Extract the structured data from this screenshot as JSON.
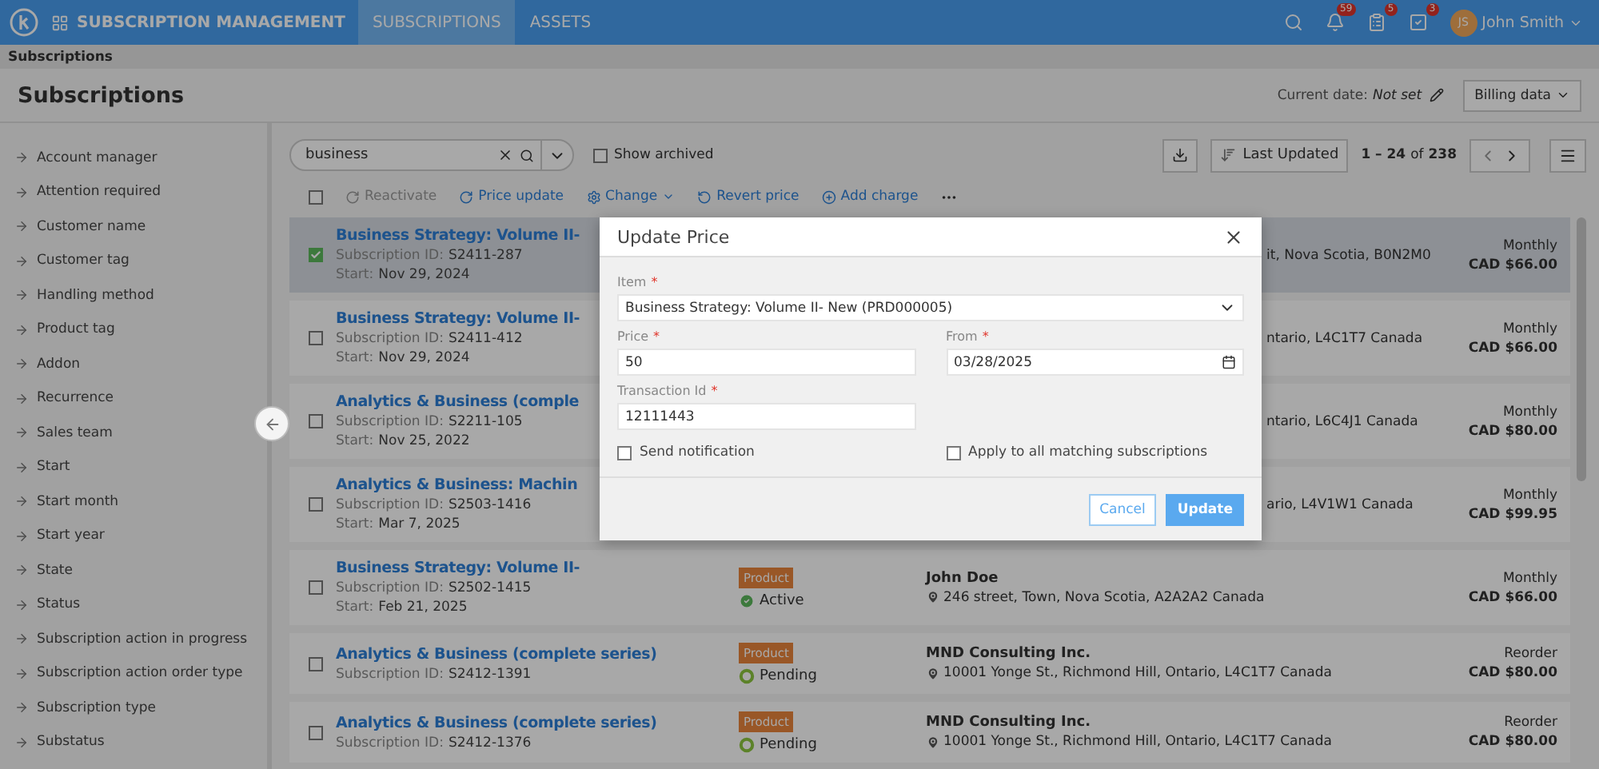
{
  "header": {
    "app_title": "SUBSCRIPTION MANAGEMENT",
    "nav": [
      {
        "label": "SUBSCRIPTIONS",
        "selected": true
      },
      {
        "label": "ASSETS",
        "selected": false
      }
    ],
    "notifications": [
      {
        "kind": "bell",
        "count": "59"
      },
      {
        "kind": "tasks",
        "count": "5"
      },
      {
        "kind": "approvals",
        "count": "3"
      }
    ],
    "user": {
      "initials": "JS",
      "name": "John Smith"
    }
  },
  "breadcrumb": "Subscriptions",
  "page": {
    "title": "Subscriptions",
    "current_date_label": "Current date:",
    "current_date_value": "Not set",
    "billing_button": "Billing data"
  },
  "sidebar": {
    "filters": [
      "Account manager",
      "Attention required",
      "Customer name",
      "Customer tag",
      "Handling method",
      "Product tag",
      "Addon",
      "Recurrence",
      "Sales team",
      "Start",
      "Start month",
      "Start year",
      "State",
      "Status",
      "Subscription action in progress",
      "Subscription action order type",
      "Subscription type",
      "Substatus"
    ]
  },
  "toolbar": {
    "search_value": "business",
    "show_archived": {
      "label": "Show archived",
      "checked": false
    },
    "sort_label": "Last Updated",
    "range": "1 – 24",
    "of": "of",
    "total": "238"
  },
  "select_all": {
    "checked": false
  },
  "actions": [
    {
      "label": "Reactivate",
      "disabled": true,
      "dropdown": false
    },
    {
      "label": "Price update",
      "disabled": false,
      "dropdown": false
    },
    {
      "label": "Change",
      "disabled": false,
      "dropdown": true
    },
    {
      "label": "Revert price",
      "disabled": false,
      "dropdown": false
    },
    {
      "label": "Add charge",
      "disabled": false,
      "dropdown": false
    }
  ],
  "subscriptions": [
    {
      "kind": "covered",
      "selected": true,
      "title": "Business Strategy: Volume II-",
      "id_label": "Subscription ID:",
      "id": "S2411-287",
      "start_label": "Start:",
      "start": "Nov 29, 2024",
      "address": "it, Nova Scotia, B0N2M0",
      "recurrence": "Monthly",
      "price": "CAD $66.00"
    },
    {
      "kind": "covered",
      "selected": false,
      "title": "Business Strategy: Volume II-",
      "id_label": "Subscription ID:",
      "id": "S2411-412",
      "start_label": "Start:",
      "start": "Nov 29, 2024",
      "address": "ntario, L4C1T7 Canada",
      "recurrence": "Monthly",
      "price": "CAD $66.00"
    },
    {
      "kind": "covered",
      "selected": false,
      "title": "Analytics & Business (comple",
      "id_label": "Subscription ID:",
      "id": "S2211-105",
      "start_label": "Start:",
      "start": "Nov 25, 2022",
      "address": "ntario, L6C4J1 Canada",
      "recurrence": "Monthly",
      "price": "CAD $80.00"
    },
    {
      "kind": "covered",
      "selected": false,
      "title": "Analytics & Business: Machin",
      "id_label": "Subscription ID:",
      "id": "S2503-1416",
      "start_label": "Start:",
      "start": "Mar 7, 2025",
      "address": "ario, L4V1W1 Canada",
      "recurrence": "Monthly",
      "price": "CAD $99.95"
    },
    {
      "kind": "full",
      "selected": false,
      "title": "Business Strategy: Volume II-",
      "id_label": "Subscription ID:",
      "id": "S2502-1415",
      "start_label": "Start:",
      "start": "Feb 21, 2025",
      "tag": "Product",
      "status": {
        "kind": "active",
        "label": "Active"
      },
      "customer": "John Doe",
      "address": "246 street, Town, Nova Scotia, A2A2A2 Canada",
      "recurrence": "Monthly",
      "price": "CAD $66.00"
    },
    {
      "kind": "full",
      "selected": false,
      "title": "Analytics & Business (complete series)",
      "id_label": "Subscription ID:",
      "id": "S2412-1391",
      "tag": "Product",
      "status": {
        "kind": "pending",
        "label": "Pending"
      },
      "customer": "MND Consulting Inc.",
      "address": "10001 Yonge St., Richmond Hill, Ontario, L4C1T7 Canada",
      "recurrence": "Reorder",
      "price": "CAD $80.00"
    },
    {
      "kind": "full",
      "selected": false,
      "title": "Analytics & Business (complete series)",
      "id_label": "Subscription ID:",
      "id": "S2412-1376",
      "tag": "Product",
      "status": {
        "kind": "pending",
        "label": "Pending"
      },
      "customer": "MND Consulting Inc.",
      "address": "10001 Yonge St., Richmond Hill, Ontario, L4C1T7 Canada",
      "recurrence": "Reorder",
      "price": "CAD $80.00"
    }
  ],
  "modal": {
    "title": "Update Price",
    "fields": [
      {
        "kind": "select",
        "label": "Item",
        "required_mark": "*",
        "value": "Business Strategy: Volume II- New (PRD000005)"
      },
      {
        "kind": "text",
        "label": "Price",
        "required_mark": "*",
        "value": "50"
      },
      {
        "kind": "date",
        "label": "From",
        "required_mark": "*",
        "value": "03/28/2025"
      },
      {
        "kind": "text",
        "label": "Transaction Id",
        "required_mark": "*",
        "value": "12111443"
      }
    ],
    "options": [
      {
        "label": "Send notification",
        "checked": false
      },
      {
        "label": "Apply to all matching subscriptions",
        "checked": false
      }
    ],
    "buttons": [
      {
        "kind": "secondary",
        "label": "Cancel"
      },
      {
        "kind": "primary",
        "label": "Update"
      }
    ]
  }
}
